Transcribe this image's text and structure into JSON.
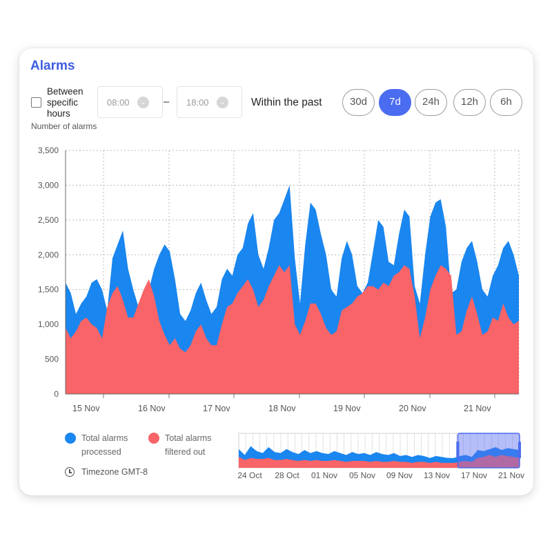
{
  "panel": {
    "title": "Alarms",
    "filter": {
      "checkbox_label": [
        "Between",
        "specific",
        "hours"
      ],
      "start_time": "08:00",
      "end_time": "18:00",
      "separator": "–",
      "within_label": "Within the past",
      "ranges": [
        "30d",
        "7d",
        "24h",
        "12h",
        "6h"
      ],
      "selected_range": "7d"
    },
    "timezone": "Timezone GMT-8"
  },
  "colors": {
    "processed": "#1a86ef",
    "filtered": "#f86467",
    "accent": "#4a6cf0",
    "title": "#3d5ce0"
  },
  "chart_data": [
    {
      "type": "area",
      "ylabel": "Number of alarms",
      "ylim": [
        0,
        3500
      ],
      "yticks": [
        "0",
        "500",
        "1,000",
        "1,500",
        "2,000",
        "2,500",
        "3,000",
        "3,500"
      ],
      "xticks": [
        "15 Nov",
        "16 Nov",
        "17 Nov",
        "18 Nov",
        "19 Nov",
        "20 Nov",
        "21 Nov"
      ],
      "grid": true,
      "legend_position": "bottom-left",
      "series": [
        {
          "name": "Total alarms processed",
          "values": [
            1600,
            1450,
            1150,
            1300,
            1400,
            1600,
            1650,
            1500,
            1200,
            1950,
            2150,
            2350,
            1800,
            1500,
            1250,
            1300,
            1500,
            1800,
            2000,
            2150,
            2050,
            1650,
            1150,
            1050,
            1200,
            1450,
            1600,
            1350,
            1150,
            1250,
            1650,
            1800,
            1700,
            2000,
            2100,
            2450,
            2600,
            2000,
            1800,
            2100,
            2500,
            2600,
            2800,
            3000,
            1950,
            1300,
            2150,
            2750,
            2650,
            2300,
            2000,
            1500,
            1400,
            1950,
            2200,
            2000,
            1550,
            1450,
            1600,
            2050,
            2500,
            2400,
            1900,
            1850,
            2300,
            2650,
            2550,
            1550,
            1300,
            2000,
            2550,
            2750,
            2800,
            2400,
            1450,
            1500,
            1900,
            2100,
            2200,
            1900,
            1500,
            1400,
            1700,
            1850,
            2100,
            2200,
            2000,
            1700
          ]
        },
        {
          "name": "Total alarms filtered out",
          "values": [
            950,
            800,
            900,
            1050,
            1100,
            1000,
            950,
            800,
            1250,
            1450,
            1550,
            1350,
            1100,
            1100,
            1300,
            1500,
            1650,
            1400,
            1050,
            850,
            700,
            800,
            650,
            600,
            700,
            900,
            1000,
            800,
            700,
            700,
            1000,
            1250,
            1300,
            1450,
            1550,
            1650,
            1500,
            1250,
            1350,
            1550,
            1700,
            1850,
            1750,
            1850,
            1000,
            850,
            1050,
            1300,
            1300,
            1150,
            950,
            850,
            900,
            1200,
            1250,
            1300,
            1400,
            1450,
            1550,
            1550,
            1500,
            1600,
            1550,
            1700,
            1750,
            1850,
            1800,
            1400,
            800,
            1100,
            1500,
            1700,
            1850,
            1800,
            1700,
            850,
            900,
            1200,
            1400,
            1150,
            850,
            900,
            1100,
            1050,
            1300,
            1100,
            1000,
            1050
          ]
        }
      ]
    },
    {
      "type": "area",
      "xticks": [
        "24 Oct",
        "28 Oct",
        "01 Nov",
        "05 Nov",
        "09 Nov",
        "13 Nov",
        "17 Nov",
        "21 Nov"
      ],
      "ylim": [
        0,
        3500
      ],
      "selection_start_fraction": 0.78,
      "series": [
        {
          "name": "Total alarms processed",
          "values": [
            1900,
            1300,
            2200,
            1700,
            1500,
            2100,
            1600,
            1500,
            1900,
            1600,
            1400,
            1800,
            1500,
            1700,
            1500,
            1400,
            1700,
            1500,
            1300,
            1600,
            1400,
            1500,
            1300,
            1600,
            1400,
            1300,
            1500,
            1200,
            1300,
            1100,
            1300,
            1200,
            1000,
            1200,
            1100,
            1000,
            1000,
            1200,
            1300,
            1100,
            1800,
            1700,
            1900,
            2100,
            1800,
            2000,
            1900,
            1800
          ]
        },
        {
          "name": "Total alarms filtered out",
          "values": [
            1100,
            800,
            1000,
            900,
            900,
            1000,
            800,
            800,
            900,
            800,
            700,
            800,
            700,
            800,
            700,
            700,
            800,
            700,
            600,
            700,
            700,
            700,
            600,
            700,
            600,
            600,
            700,
            600,
            600,
            500,
            600,
            600,
            500,
            600,
            500,
            500,
            500,
            600,
            700,
            600,
            1000,
            1100,
            1300,
            1100,
            1300,
            1200,
            1100,
            1000
          ]
        }
      ]
    }
  ]
}
